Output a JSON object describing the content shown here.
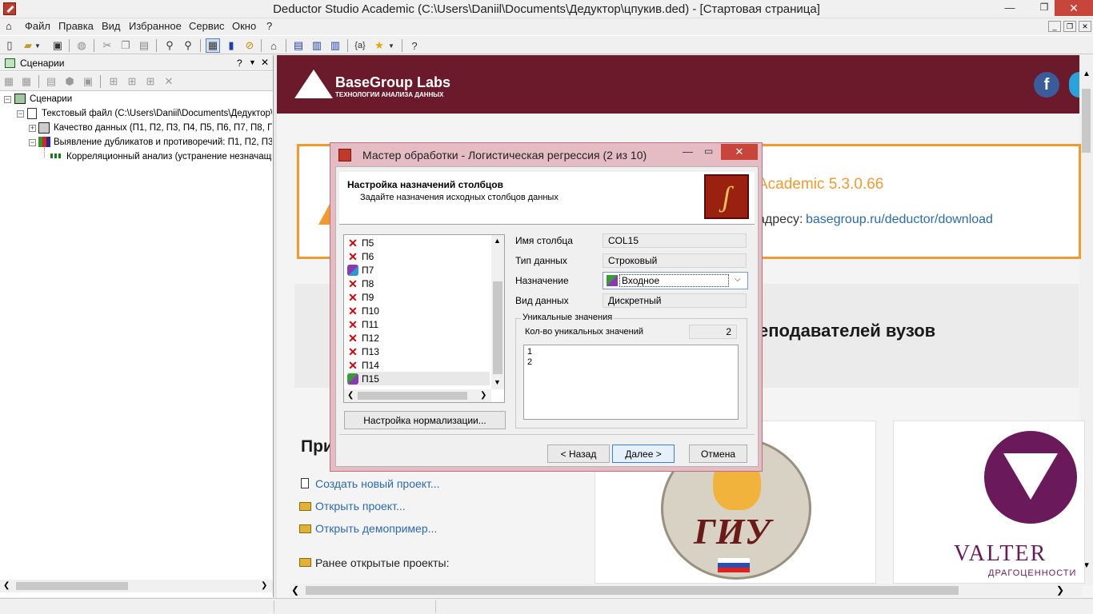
{
  "window": {
    "title": "Deductor Studio Academic (C:\\Users\\Daniil\\Documents\\Дедуктор\\цпукив.ded) - [Стартовая страница]"
  },
  "menu": [
    "Файл",
    "Правка",
    "Вид",
    "Избранное",
    "Сервис",
    "Окно",
    "?"
  ],
  "left_panel": {
    "title": "Сценарии",
    "header_help": "?",
    "tree": [
      {
        "label": "Сценарии"
      },
      {
        "label": "Текстовый файл (C:\\Users\\Daniil\\Documents\\Дедуктор\\"
      },
      {
        "label": "Качество данных (П1, П2, П3, П4, П5, П6, П7, П8, П9,"
      },
      {
        "label": "Выявление дубликатов и противоречий: П1, П2, П3, П"
      },
      {
        "label": "Корреляционный анализ (устранение незначащих"
      }
    ]
  },
  "start_page": {
    "brand": "BaseGroup Labs",
    "brand_sub": "ТЕХНОЛОГИИ АНАЛИЗА ДАННЫХ",
    "version_text": "Academic 5.3.0.66",
    "download_prefix": "адресу:",
    "download_link": "basegroup.ru/deductor/download",
    "headline": "еподавателей вузов",
    "section_title": "При",
    "links": [
      "Создать новый проект...",
      "Открыть проект...",
      "Открыть демопример..."
    ],
    "recent_title": "Ранее открытые проекты:",
    "logo1_text": "ГИУ",
    "logo2_text": "VALTER",
    "logo2_sub": "ДРАГОЦЕННОСТИ"
  },
  "dialog": {
    "title": "Мастер обработки - Логистическая регрессия (2 из 10)",
    "step_title": "Настройка назначений столбцов",
    "step_subtitle": "Задайте назначения исходных столбцов данных",
    "columns": [
      {
        "name": "П5",
        "icon": "excluded-icon"
      },
      {
        "name": "П6",
        "icon": "excluded-icon"
      },
      {
        "name": "П7",
        "icon": "output-icon"
      },
      {
        "name": "П8",
        "icon": "excluded-icon"
      },
      {
        "name": "П9",
        "icon": "excluded-icon"
      },
      {
        "name": "П10",
        "icon": "excluded-icon"
      },
      {
        "name": "П11",
        "icon": "excluded-icon"
      },
      {
        "name": "П12",
        "icon": "excluded-icon"
      },
      {
        "name": "П13",
        "icon": "excluded-icon"
      },
      {
        "name": "П14",
        "icon": "excluded-icon"
      },
      {
        "name": "П15",
        "icon": "input-icon"
      }
    ],
    "labels": {
      "column_name": "Имя столбца",
      "data_type": "Тип данных",
      "purpose": "Назначение",
      "data_kind": "Вид данных",
      "unique_group": "Уникальные значения",
      "unique_count": "Кол-во уникальных значений"
    },
    "values": {
      "column_name": "COL15",
      "data_type": "Строковый",
      "purpose": "Входное",
      "data_kind": "Дискретный",
      "unique_count": "2"
    },
    "unique_values": [
      "1",
      "2"
    ],
    "normalize_button": "Настройка нормализации...",
    "back_button": "< Назад",
    "next_button": "Далее >",
    "cancel_button": "Отмена"
  }
}
